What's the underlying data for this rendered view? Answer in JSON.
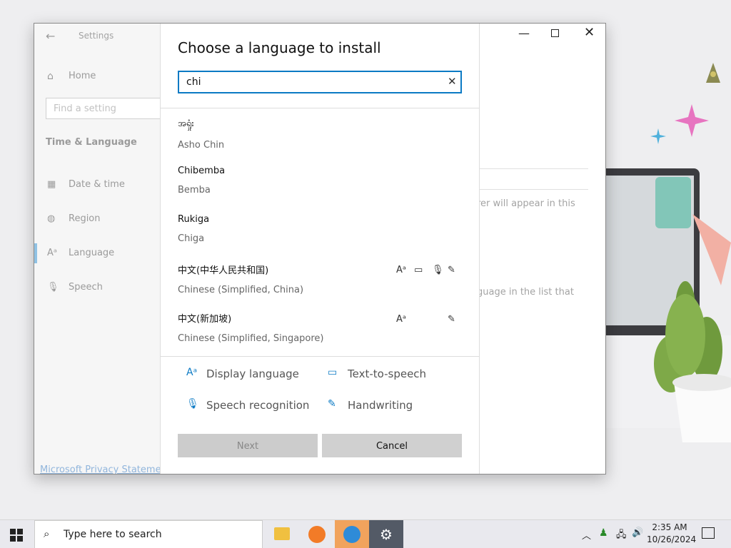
{
  "settings": {
    "title": "Settings",
    "home": "Home",
    "find_placeholder": "Find a setting",
    "section": "Time & Language",
    "nav": [
      {
        "label": "Date & time"
      },
      {
        "label": "Region"
      },
      {
        "label": "Language"
      },
      {
        "label": "Speech"
      }
    ],
    "bg_text_1": "rer will appear in this",
    "bg_text_2": "guage in the list that",
    "privacy_link": "Microsoft Privacy Statement"
  },
  "dialog": {
    "title": "Choose a language to install",
    "search_value": "chi",
    "languages": [
      {
        "native": "အရှုံး",
        "english": "Asho Chin"
      },
      {
        "native": "Chibemba",
        "english": "Bemba"
      },
      {
        "native": "Rukiga",
        "english": "Chiga"
      },
      {
        "native": "中文(中华人民共和国)",
        "english": "Chinese (Simplified, China)"
      },
      {
        "native": "中文(新加坡)",
        "english": "Chinese (Simplified, Singapore)"
      }
    ],
    "features": {
      "display": "Display language",
      "tts": "Text-to-speech",
      "speech": "Speech recognition",
      "handwriting": "Handwriting"
    },
    "next": "Next",
    "cancel": "Cancel"
  },
  "taskbar": {
    "search_placeholder": "Type here to search",
    "time": "2:35 AM",
    "date": "10/26/2024"
  }
}
